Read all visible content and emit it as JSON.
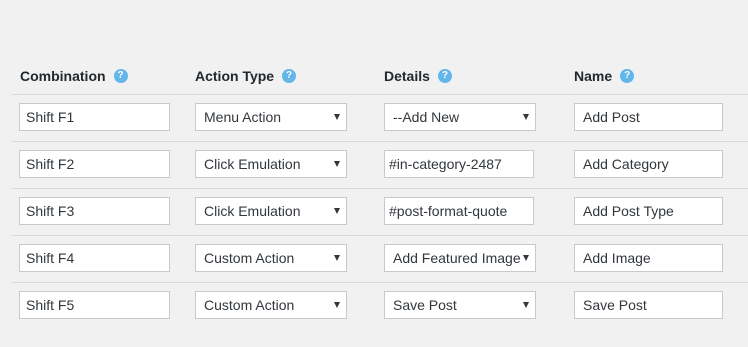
{
  "table": {
    "headers": {
      "combination": "Combination",
      "action_type": "Action Type",
      "details": "Details",
      "name": "Name",
      "help_glyph": "?"
    },
    "rows": [
      {
        "combination": "Shift F1",
        "action_type": "Menu Action",
        "details": "--Add New",
        "name": "Add Post"
      },
      {
        "combination": "Shift F2",
        "action_type": "Click Emulation",
        "details": "#in-category-2487",
        "name": "Add Category"
      },
      {
        "combination": "Shift F3",
        "action_type": "Click Emulation",
        "details": "#post-format-quote",
        "name": "Add Post Type"
      },
      {
        "combination": "Shift F4",
        "action_type": "Custom Action",
        "details": "Add Featured Image",
        "name": "Add Image"
      },
      {
        "combination": "Shift F5",
        "action_type": "Custom Action",
        "details": "Save Post",
        "name": "Save Post"
      }
    ]
  },
  "colors": {
    "background": "#f1f1f1",
    "help_icon": "#63b6ea",
    "border": "#c9c9c9",
    "text": "#32373c",
    "heading": "#23282d"
  },
  "icons": {
    "help": "question-circle-icon",
    "dropdown": "caret-down-icon"
  }
}
